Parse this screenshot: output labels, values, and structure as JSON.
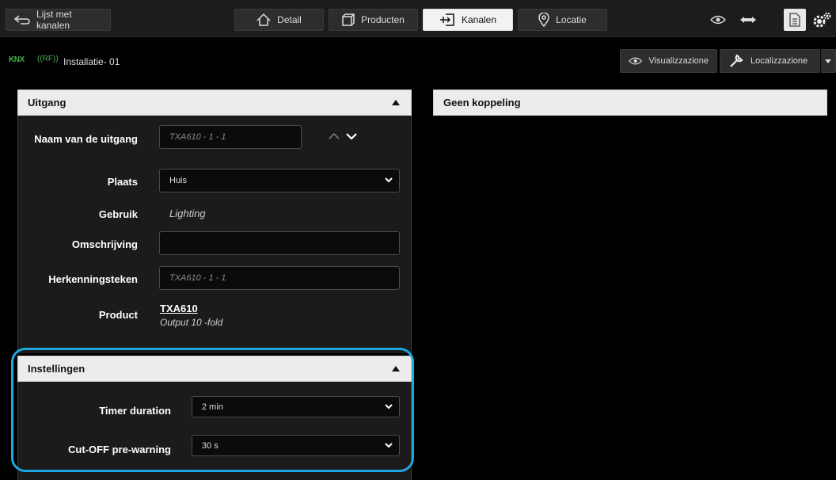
{
  "topbar": {
    "back_label": "Lijst met kanalen",
    "tabs": [
      {
        "label": "Detail",
        "icon": "home-icon"
      },
      {
        "label": "Producten",
        "icon": "cube-icon"
      },
      {
        "label": "Kanalen",
        "icon": "channel-icon",
        "active": true
      },
      {
        "label": "Locatie",
        "icon": "location-pin-icon"
      }
    ],
    "right_icons": [
      "eye-icon",
      "arrows-icon",
      "document-icon",
      "settings-gears-icon"
    ]
  },
  "subbar": {
    "knx_label": "KNX",
    "rf_label": "((RF))",
    "installation_title": "Installatie- 01",
    "visual_label": "Visualizzazione",
    "local_label": "Localizzazione"
  },
  "output_panel": {
    "header": "Uitgang",
    "name_label": "Naam van de uitgang",
    "name_placeholder": "TXA610 - 1 - 1",
    "place_label": "Plaats",
    "place_value": "Huis",
    "usage_label": "Gebruik",
    "usage_value": "Lighting",
    "desc_label": "Omschrijving",
    "desc_value": "",
    "tag_label": "Herkenningsteken",
    "tag_placeholder": "TXA610 - 1 - 1",
    "product_label": "Product",
    "product_code": "TXA610",
    "product_desc": "Output 10 -fold"
  },
  "settings_panel": {
    "header": "Instellingen",
    "timer_label": "Timer duration",
    "timer_value": "2 min",
    "cutoff_label": "Cut-OFF pre-warning",
    "cutoff_value": "30 s"
  },
  "link_panel": {
    "header": "Geen koppeling"
  },
  "colors": {
    "accent_highlight": "#1ea7e0",
    "knx_green": "#4caf50"
  }
}
